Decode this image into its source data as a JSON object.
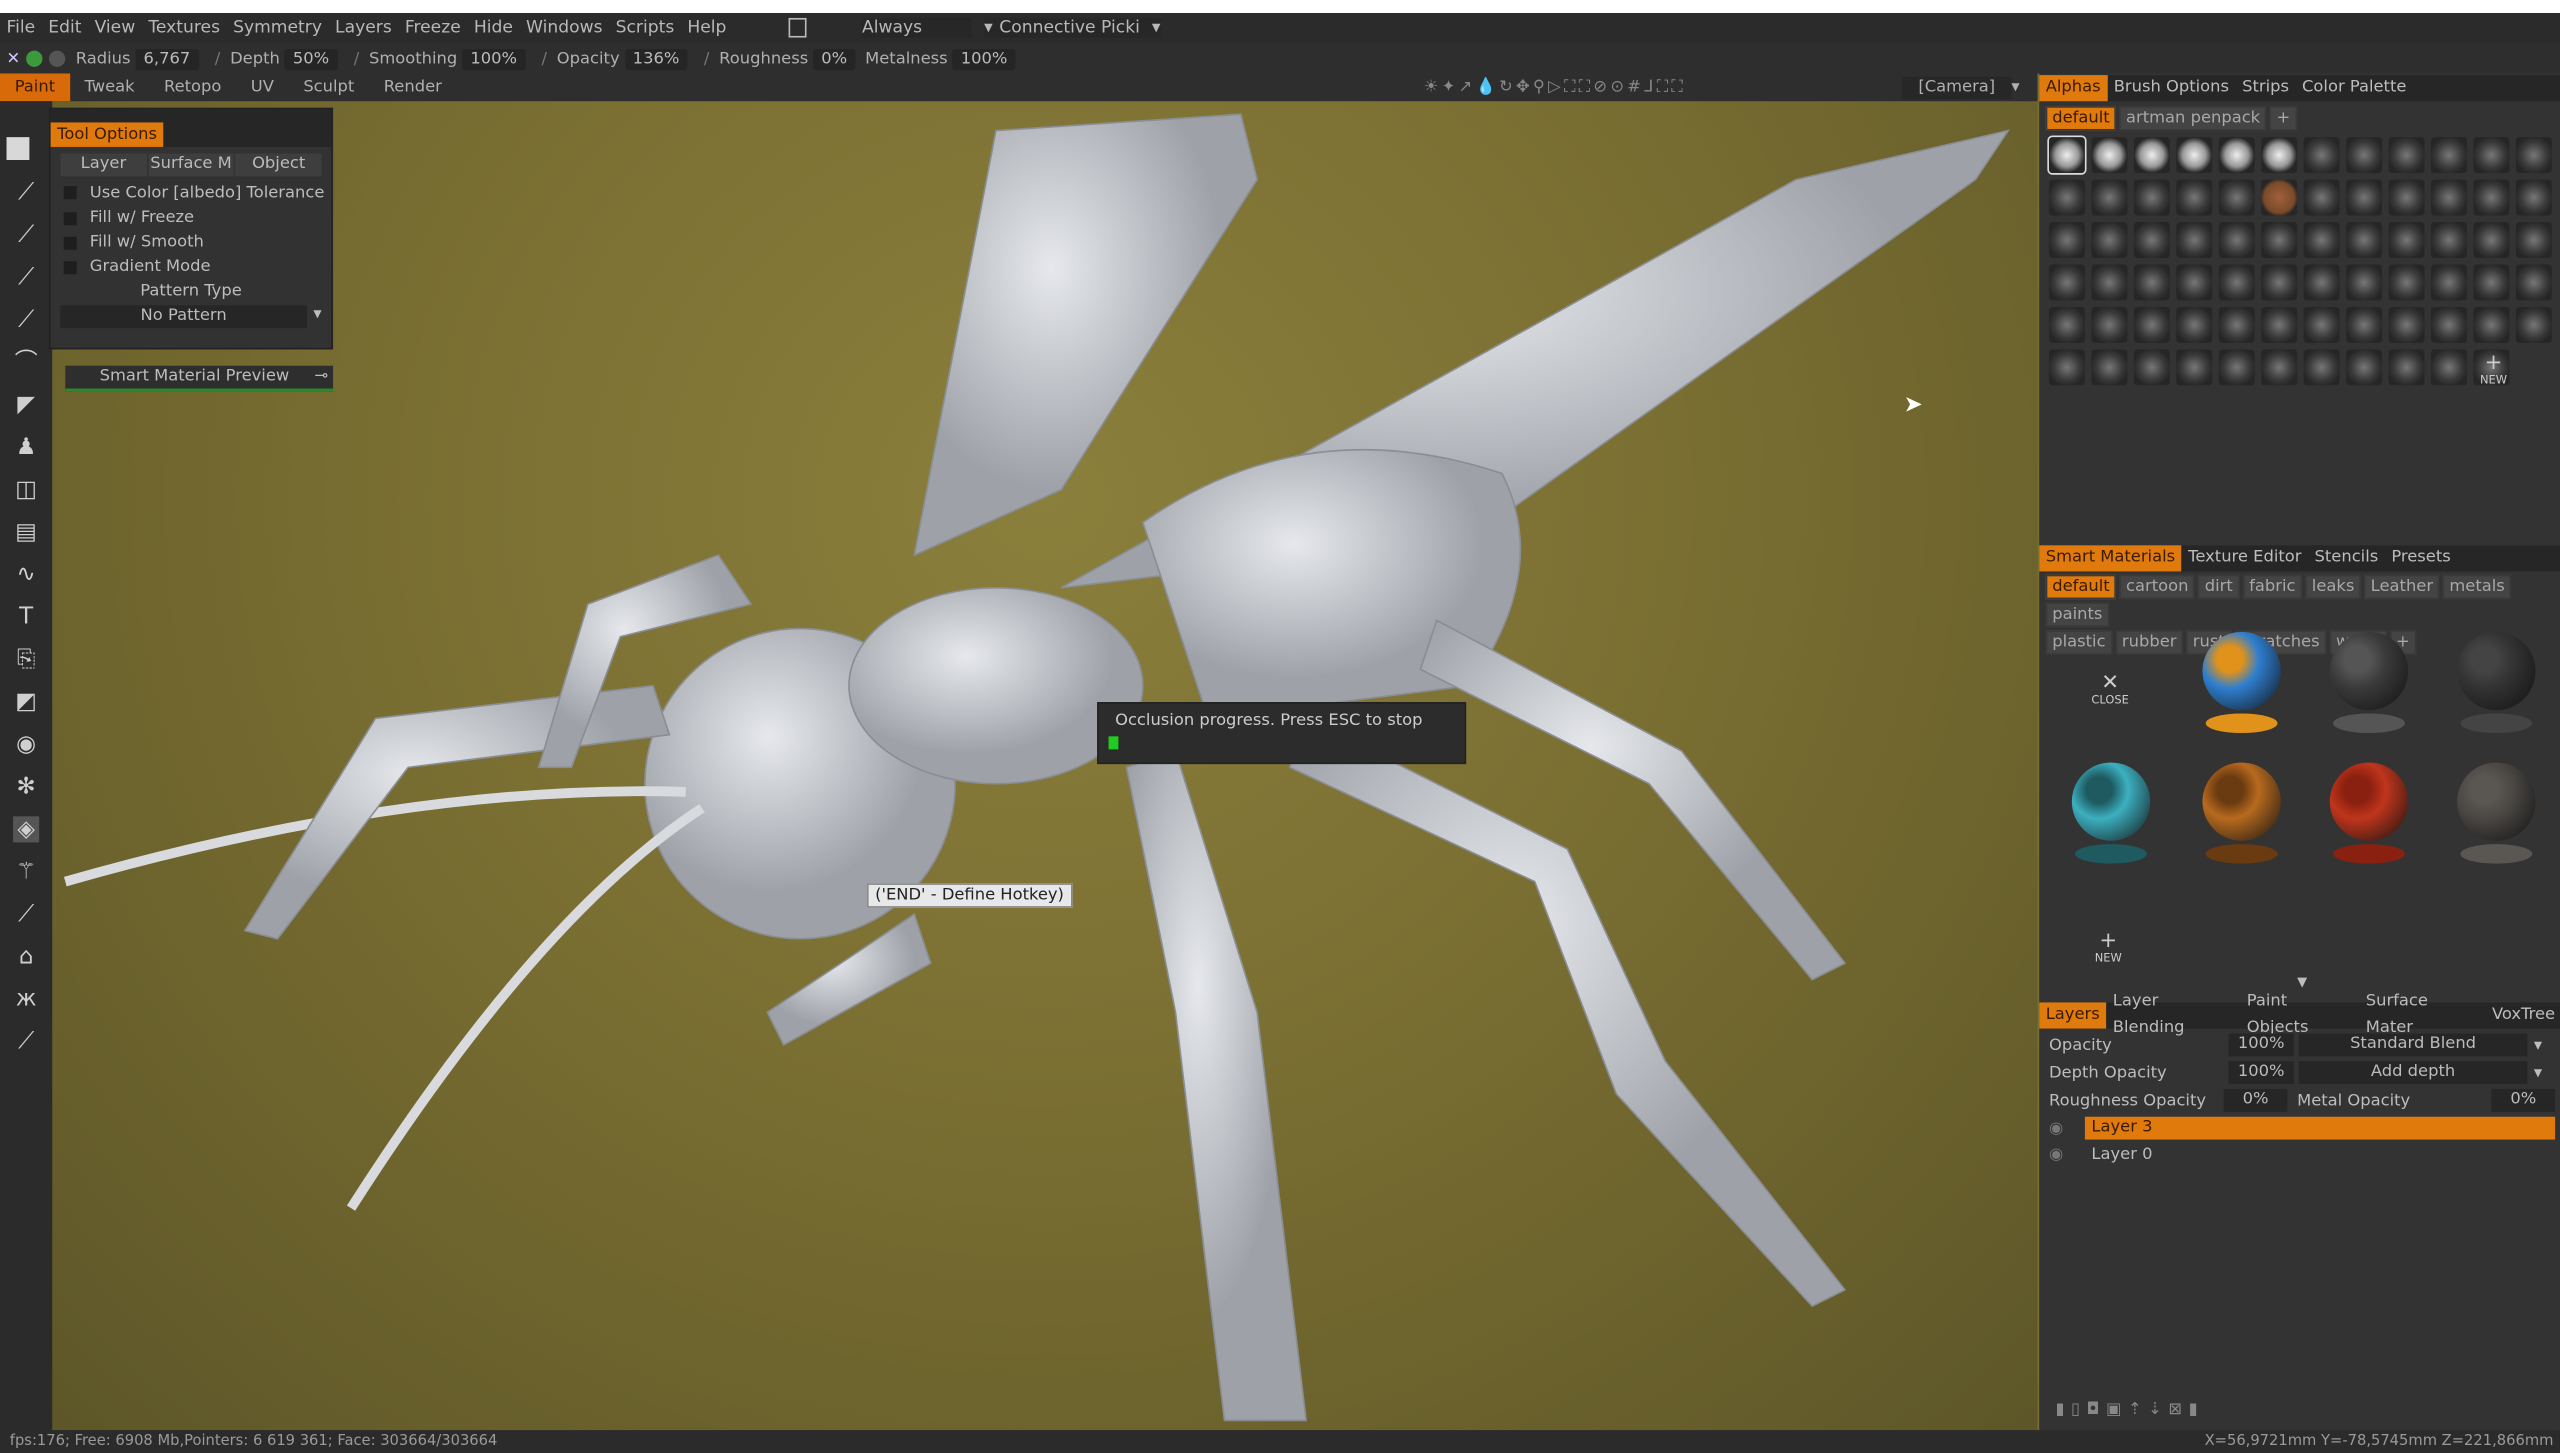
{
  "menu": [
    "File",
    "Edit",
    "View",
    "Textures",
    "Symmetry",
    "Layers",
    "Freeze",
    "Hide",
    "Windows",
    "Scripts",
    "Help"
  ],
  "menu_extra": {
    "always": "Always",
    "picking": "Connective Picki"
  },
  "toolbar": {
    "radius_label": "Radius",
    "radius": "6,767",
    "depth_label": "Depth",
    "depth": "50%",
    "smoothing_label": "Smoothing",
    "smoothing": "100%",
    "opacity_label": "Opacity",
    "opacity": "136%",
    "roughness_label": "Roughness",
    "roughness": "0%",
    "metalness_label": "Metalness",
    "metalness": "100%"
  },
  "modes": [
    "Paint",
    "Tweak",
    "Retopo",
    "UV",
    "Sculpt",
    "Render"
  ],
  "camera": "[Camera]",
  "tool_options": {
    "title": "Tool Options",
    "tabs": [
      "Layer",
      "Surface M",
      "Object"
    ],
    "checks": [
      "Use Color [albedo] Tolerance",
      "Fill w/ Freeze",
      "Fill w/ Smooth",
      "Gradient Mode"
    ],
    "pattern_label": "Pattern Type",
    "pattern_value": "No Pattern"
  },
  "smart_preview": "Smart Material Preview",
  "occlusion": "Occlusion progress. Press ESC to stop",
  "hotkey": "('END' - Define Hotkey)",
  "alphas": {
    "tabs": [
      "Alphas",
      "Brush Options",
      "Strips",
      "Color Palette"
    ],
    "sets": [
      "default",
      "artman penpack"
    ]
  },
  "smart": {
    "tabs": [
      "Smart Materials",
      "Texture Editor",
      "Stencils",
      "Presets"
    ],
    "tags": [
      "default",
      "cartoon",
      "dirt",
      "fabric",
      "leaks",
      "Leather",
      "metals",
      "paints",
      "plastic",
      "rubber",
      "rust",
      "scratches",
      "wood"
    ],
    "close": "CLOSE",
    "new": "NEW",
    "new_alpha": "NEW",
    "materials": [
      {
        "color": "#2f7fd0",
        "ring": "#e0921a"
      },
      {
        "color": "#3a3a3a",
        "ring": "#555"
      },
      {
        "color": "#333",
        "ring": "#444"
      },
      {
        "color": "#3cb0c0",
        "ring": "#1e5a60"
      },
      {
        "color": "#b86a1e",
        "ring": "#6a3a10"
      },
      {
        "color": "#c0351c",
        "ring": "#8a2010"
      },
      {
        "color": "#4a4744",
        "ring": "#5a5652"
      }
    ]
  },
  "layers": {
    "tabs": [
      "Layers",
      "Layer Blending",
      "Paint Objects",
      "Surface Mater",
      "VoxTree"
    ],
    "opacity_label": "Opacity",
    "opacity": "100%",
    "blend": "Standard Blend",
    "depth_label": "Depth Opacity",
    "depth": "100%",
    "depth_mode": "Add depth",
    "rough_label": "Roughness Opacity",
    "rough": "0%",
    "metal_label": "Metal Opacity",
    "metal": "0%",
    "items": [
      "Layer 3",
      "Layer 0"
    ]
  },
  "status": {
    "left": "fps:176;  Free: 6908 Mb,Pointers: 6 619 361; Face: 303664/303664",
    "right": "X=56,9721mm Y=-78,5745mm Z=221,866mm"
  }
}
